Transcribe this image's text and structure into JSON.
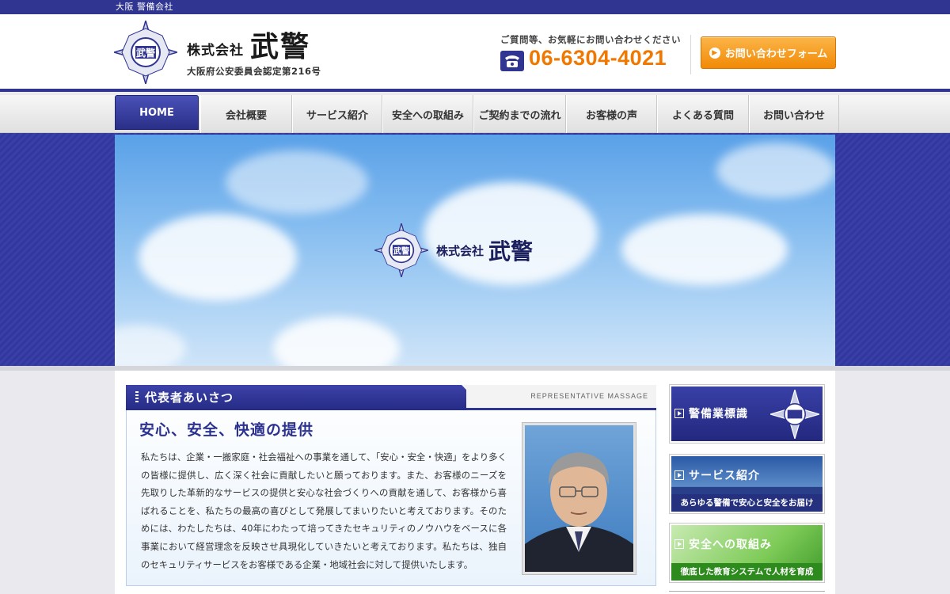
{
  "site_tag": "大阪 警備会社",
  "header": {
    "company_prefix": "株式会社",
    "company_name": "武警",
    "license": "大阪府公安委員会認定第216号",
    "contact_lead": "ご質問等、お気軽にお問い合わせください",
    "phone": "06-6304-4021",
    "form_button": "お問い合わせフォーム",
    "emblem_text": "武警"
  },
  "nav": {
    "items": [
      {
        "label": "HOME",
        "active": true
      },
      {
        "label": "会社概要"
      },
      {
        "label": "サービス紹介"
      },
      {
        "label": "安全への取組み"
      },
      {
        "label": "ご契約までの流れ"
      },
      {
        "label": "お客様の声"
      },
      {
        "label": "よくある質問"
      },
      {
        "label": "お問い合わせ"
      }
    ]
  },
  "hero": {
    "company_prefix": "株式会社",
    "company_name": "武警"
  },
  "greeting": {
    "title": "代表者あいさつ",
    "subtitle": "REPRESENTATIVE MASSAGE",
    "lead": "安心、安全、快適の提供",
    "body": "私たちは、企業・一搬家庭・社会福祉への事業を通して、「安心・安全・快適」をより多くの皆様に提供し、広く深く社会に貢献したいと願っております。また、お客様のニーズを先取りした革新的なサービスの提供と安心な社会づくりへの貢献を通して、お客様から喜ばれることを、私たちの最高の喜びとして発展してまいりたいと考えております。そのためには、わたしたちは、40年にわたって培ってきたセキュリティのノウハウをベースに各事業において経営理念を反映させ具現化していきたいと考えております。私たちは、独自のセキュリティサービスをお客様である企業・地域社会に対して提供いたします。"
  },
  "side_banners": [
    {
      "label": "警備業標識",
      "caption": ""
    },
    {
      "label": "サービス紹介",
      "caption": "あらゆる警備で安心と安全をお届け"
    },
    {
      "label": "安全への取組み",
      "caption": "徹底した教育システムで人材を育成"
    }
  ],
  "colors": {
    "brand_navy": "#2f3591",
    "accent_orange": "#f07800",
    "sky": "#86bdf0"
  }
}
